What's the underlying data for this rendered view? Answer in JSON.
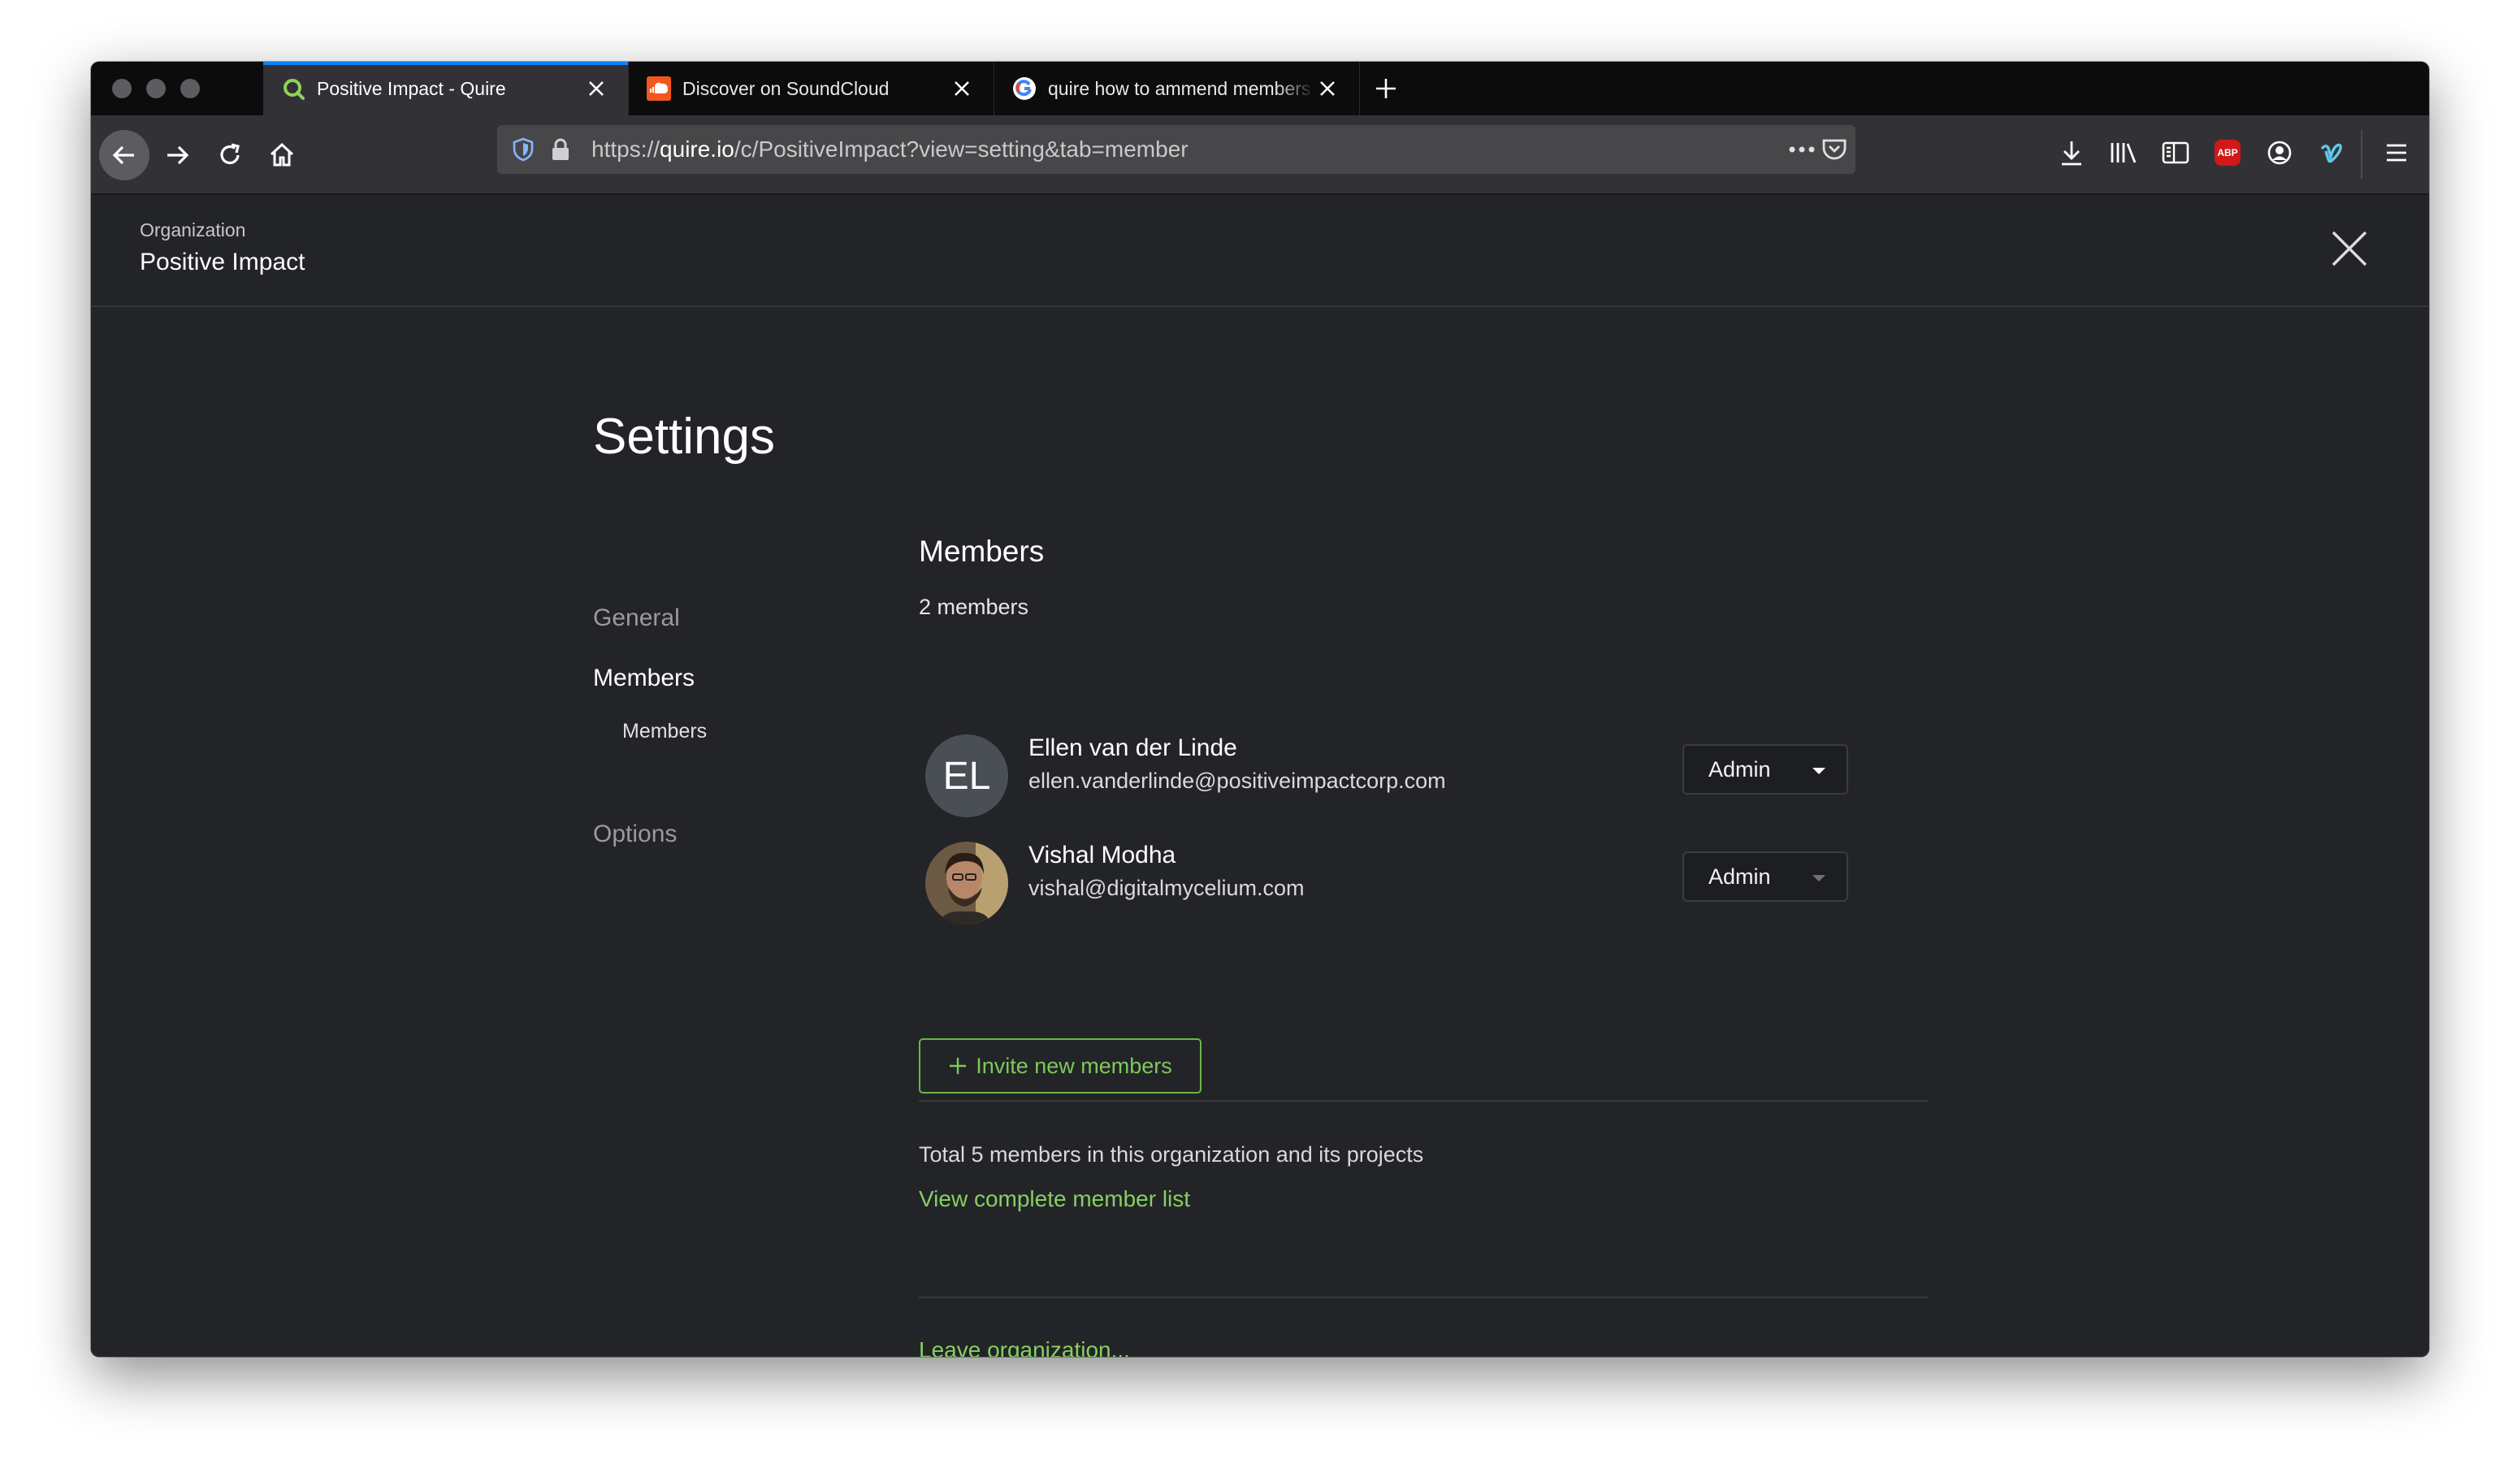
{
  "browser": {
    "tabs": [
      {
        "title": "Positive Impact - Quire",
        "icon": "quire-icon",
        "active": true
      },
      {
        "title": "Discover on SoundCloud",
        "icon": "soundcloud-icon",
        "active": false
      },
      {
        "title": "quire how to ammend members",
        "icon": "google-icon",
        "active": false
      }
    ],
    "url_prefix": "https://",
    "url_domain": "quire.io",
    "url_path": "/c/PositiveImpact?view=setting&tab=member"
  },
  "org": {
    "label": "Organization",
    "name": "Positive Impact"
  },
  "settings": {
    "title": "Settings",
    "nav": {
      "general": "General",
      "members": "Members",
      "members_sub": "Members",
      "options": "Options"
    }
  },
  "members": {
    "title": "Members",
    "count_text": "2 members",
    "list": [
      {
        "initials": "EL",
        "name": "Ellen van der Linde",
        "email": "ellen.vanderlinde@positiveimpactcorp.com",
        "role": "Admin"
      },
      {
        "initials": "",
        "name": "Vishal Modha",
        "email": "vishal@digitalmycelium.com",
        "role": "Admin"
      }
    ],
    "invite_label": "Invite new members",
    "total_text": "Total 5 members in this organization and its projects",
    "view_list_label": "View complete member list",
    "leave_label": "Leave organization..."
  },
  "colors": {
    "accent_green": "#7cc95a",
    "background": "#232428",
    "tab_active_indicator": "#0a84ff"
  }
}
